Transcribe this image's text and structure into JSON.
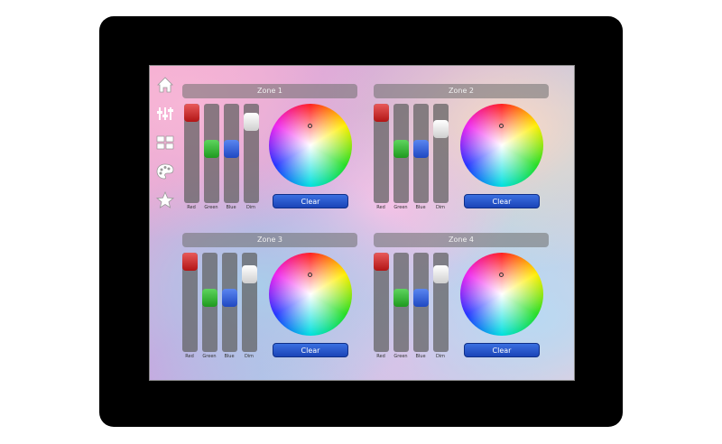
{
  "nav": [
    {
      "name": "home-icon"
    },
    {
      "name": "sliders-icon"
    },
    {
      "name": "zones-grid-icon"
    },
    {
      "name": "palette-icon"
    },
    {
      "name": "star-icon"
    }
  ],
  "zones": [
    {
      "title": "Zone 1"
    },
    {
      "title": "Zone 2"
    },
    {
      "title": "Zone 3"
    },
    {
      "title": "Zone 4"
    }
  ],
  "labels": {
    "red": "Red",
    "green": "Green",
    "blue": "Blue",
    "dim": "Dim",
    "clear": "Clear"
  },
  "slider_levels": {
    "red": 1.0,
    "green": 0.55,
    "blue": 0.55,
    "dim": 0.9
  },
  "colors": {
    "red_thumb": "#d23030",
    "green_thumb": "#2fb82f",
    "blue_thumb": "#2f5ed8",
    "clear_button": "#2a5bd0",
    "bezel": "#000000"
  }
}
